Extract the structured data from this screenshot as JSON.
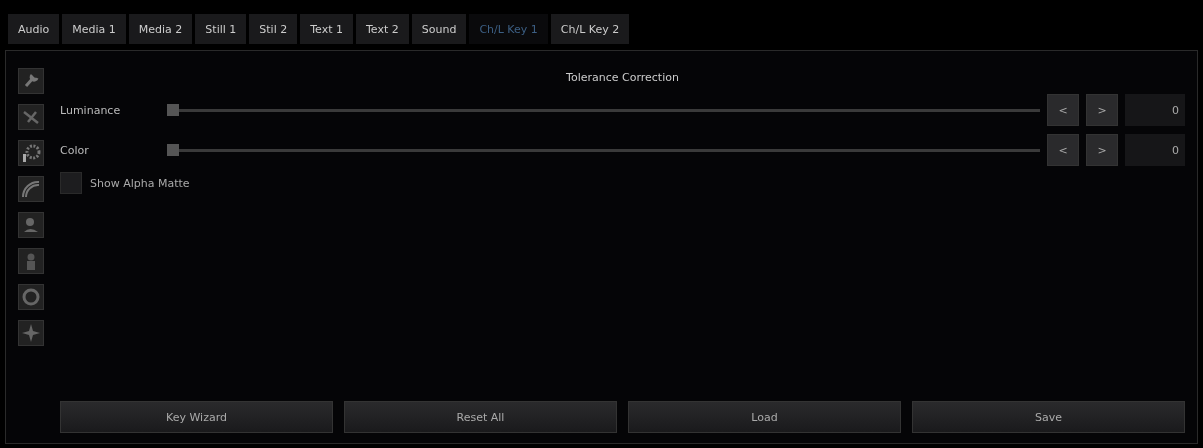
{
  "tabs": [
    {
      "label": "Audio",
      "selected": false
    },
    {
      "label": "Media 1",
      "selected": false
    },
    {
      "label": "Media 2",
      "selected": false
    },
    {
      "label": "Still 1",
      "selected": false
    },
    {
      "label": "Stil 2",
      "selected": false
    },
    {
      "label": "Text 1",
      "selected": false
    },
    {
      "label": "Text 2",
      "selected": false
    },
    {
      "label": "Sound",
      "selected": false
    },
    {
      "label": "Ch/L Key 1",
      "selected": true
    },
    {
      "label": "Ch/L Key 2",
      "selected": false
    }
  ],
  "section_title": "Tolerance Correction",
  "sliders": [
    {
      "label": "Luminance",
      "level": 0,
      "decrement": "<",
      "increment": ">",
      "value": "0"
    },
    {
      "label": "Color",
      "level": 0,
      "decrement": "<",
      "increment": ">",
      "value": "0"
    }
  ],
  "show_alpha_matte": {
    "label": "Show Alpha Matte",
    "checked": false
  },
  "buttons": [
    "Key Wizard",
    "Reset All",
    "Load",
    "Save"
  ]
}
